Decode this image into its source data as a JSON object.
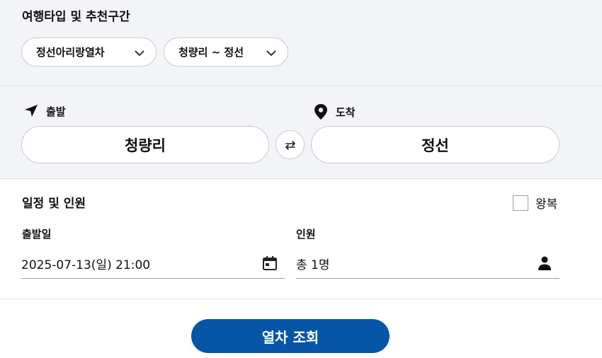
{
  "travel_type": {
    "title": "여행타입 및 추천구간",
    "type_select": "정선아리랑열차",
    "route_select": "청량리 ~ 정선"
  },
  "route": {
    "departure_label": "출발",
    "arrival_label": "도착",
    "departure_station": "청량리",
    "arrival_station": "정선"
  },
  "schedule": {
    "title": "일정 및 인원",
    "round_trip_label": "왕복",
    "date_label": "출발일",
    "date_value": "2025-07-13(일) 21:00",
    "passengers_label": "인원",
    "passengers_value": "총 1명"
  },
  "search_button": "열차 조회",
  "colors": {
    "primary": "#0755a6",
    "section_bg": "#f3f4f8",
    "border": "#c8cbd2"
  }
}
